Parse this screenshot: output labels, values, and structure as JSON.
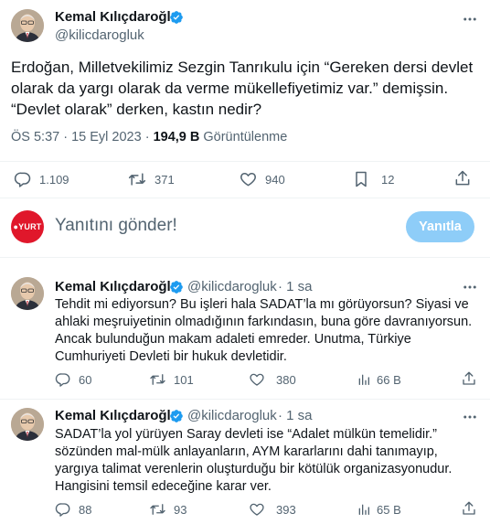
{
  "main_tweet": {
    "author_name": "Kemal Kılıçdaroğlu",
    "author_handle": "@kilicdarogluk",
    "text": "Erdoğan, Milletvekilimiz Sezgin Tanrıkulu için “Gereken dersi devlet olarak da yargı olarak da verme mükellefiyetimiz var.” demişsin. “Devlet olarak” derken, kastın nedir?",
    "time": "ÖS 5:37 · 15 Eyl 2023 · ",
    "views_count": "194,9 B",
    "views_label": " Görüntülenme",
    "stats": {
      "replies": "1.109",
      "retweets": "371",
      "likes": "940",
      "bookmarks": "12"
    }
  },
  "compose": {
    "avatar_text": "●YURT",
    "placeholder": "Yanıtını gönder!",
    "button_label": "Yanıtla"
  },
  "replies": [
    {
      "author_name": "Kemal Kılıçdaroğlu",
      "author_handle": "@kilicdarogluk",
      "time": "· 1 sa",
      "text": "Tehdit mi ediyorsun? Bu işleri hala SADAT’la mı görüyorsun? Siyasi ve ahlaki meşruiyetinin olmadığının farkındasın, buna göre davranıyorsun. Ancak bulunduğun makam adaleti emreder. Unutma, Türkiye Cumhuriyeti Devleti bir hukuk devletidir.",
      "stats": {
        "replies": "60",
        "retweets": "101",
        "likes": "380",
        "views": "66 B"
      }
    },
    {
      "author_name": "Kemal Kılıçdaroğlu",
      "author_handle": "@kilicdarogluk",
      "time": "· 1 sa",
      "text": "SADAT’la yol yürüyen Saray devleti ise “Adalet mülkün temelidir.” sözünden mal-mülk anlayanların, AYM kararlarını dahi tanımayıp, yargıya talimat verenlerin oluşturduğu bir kötülük organizasyonudur. Hangisini temsil edeceğine karar ver.",
      "stats": {
        "replies": "88",
        "retweets": "93",
        "likes": "393",
        "views": "65 B"
      }
    }
  ],
  "colors": {
    "text_primary": "#0f1419",
    "text_secondary": "#536471",
    "verified_blue": "#1d9bf0",
    "reply_button": "#8ecdf8",
    "yurt_red": "#e0172b",
    "divider": "#eff3f4"
  },
  "icons": [
    "verified-badge-icon",
    "more-options-icon",
    "reply-icon",
    "retweet-icon",
    "like-icon",
    "bookmark-icon",
    "share-icon",
    "views-icon"
  ]
}
